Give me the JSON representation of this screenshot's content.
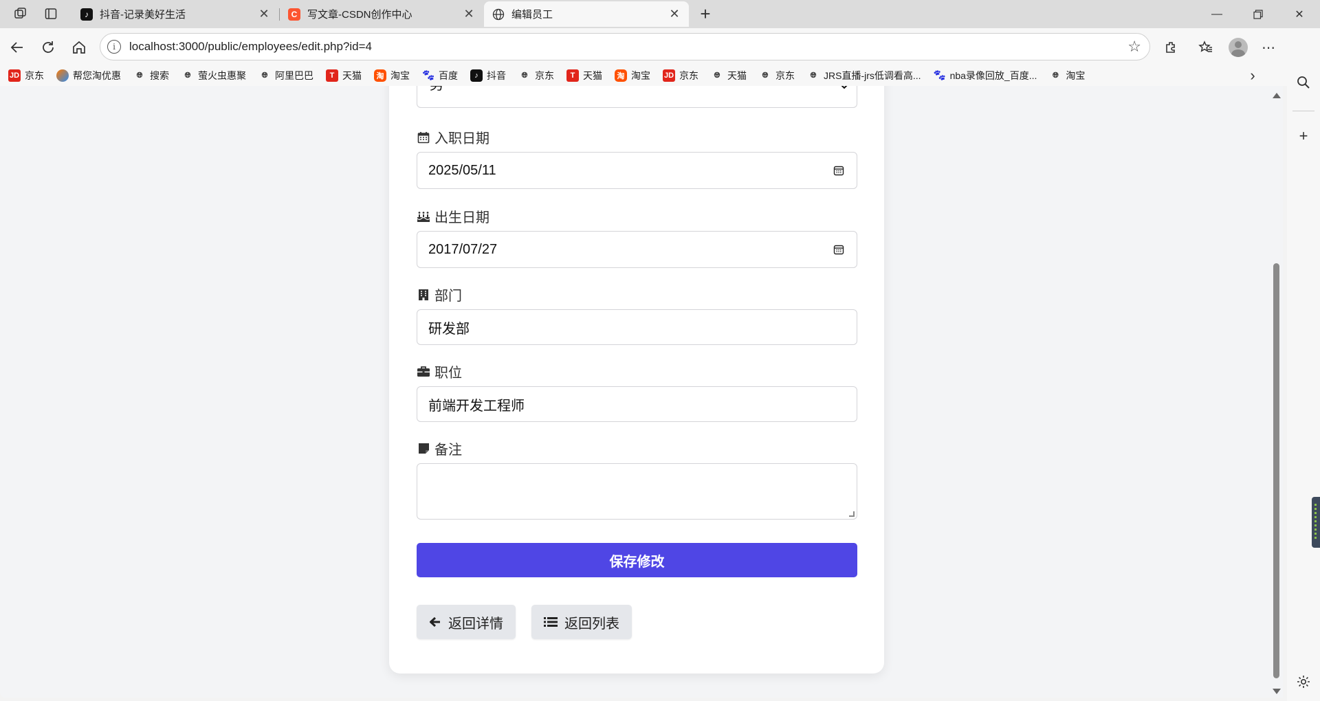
{
  "browser": {
    "tabs": [
      {
        "title": "抖音-记录美好生活",
        "active": false
      },
      {
        "title": "写文章-CSDN创作中心",
        "active": false
      },
      {
        "title": "编辑员工",
        "active": true
      }
    ],
    "url": "localhost:3000/public/employees/edit.php?id=4",
    "bookmarks": [
      {
        "label": "京东",
        "icon": "jd-icon"
      },
      {
        "label": "帮您淘优惠",
        "icon": "coupon-icon"
      },
      {
        "label": "搜索",
        "icon": "globe-icon"
      },
      {
        "label": "萤火虫惠聚",
        "icon": "globe-icon"
      },
      {
        "label": "阿里巴巴",
        "icon": "globe-icon"
      },
      {
        "label": "天猫",
        "icon": "tmall-icon"
      },
      {
        "label": "淘宝",
        "icon": "taobao-icon"
      },
      {
        "label": "百度",
        "icon": "baidu-icon"
      },
      {
        "label": "抖音",
        "icon": "douyin-icon"
      },
      {
        "label": "京东",
        "icon": "globe-icon"
      },
      {
        "label": "天猫",
        "icon": "tmall-icon"
      },
      {
        "label": "淘宝",
        "icon": "taobao-icon"
      },
      {
        "label": "京东",
        "icon": "jd-icon"
      },
      {
        "label": "天猫",
        "icon": "globe-icon"
      },
      {
        "label": "京东",
        "icon": "globe-icon"
      },
      {
        "label": "JRS直播-jrs低调看高...",
        "icon": "globe-icon"
      },
      {
        "label": "nba录像回放_百度...",
        "icon": "baidu-icon"
      },
      {
        "label": "淘宝",
        "icon": "globe-icon"
      }
    ]
  },
  "form": {
    "gender_value": "男",
    "hire_date": {
      "label": "入职日期",
      "value": "2025/05/11"
    },
    "birth_date": {
      "label": "出生日期",
      "value": "2017/07/27"
    },
    "department": {
      "label": "部门",
      "value": "研发部"
    },
    "position": {
      "label": "职位",
      "value": "前端开发工程师"
    },
    "notes": {
      "label": "备注",
      "value": ""
    },
    "save_label": "保存修改",
    "back_detail_label": "返回详情",
    "back_list_label": "返回列表"
  },
  "colors": {
    "primary": "#4f46e5",
    "secondary_button": "#e5e7eb"
  }
}
